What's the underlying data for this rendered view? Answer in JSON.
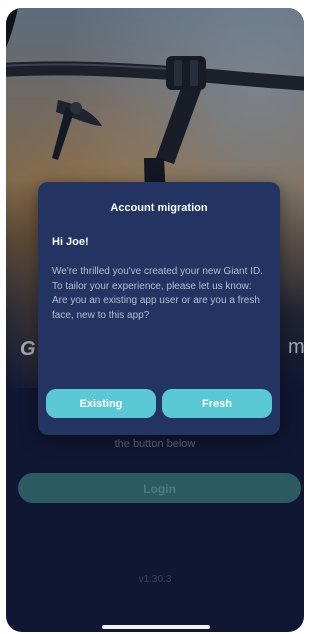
{
  "background": {
    "brand_partial_left": "G",
    "brand_partial_right": "m",
    "hint_text": "the button below",
    "login_label": "Login",
    "version": "v1.30.3"
  },
  "modal": {
    "title": "Account migration",
    "greeting": "Hi Joe!",
    "body_lines": [
      "We're thrilled you've created your new Giant ID. To tailor your experience, please let us know:",
      "Are you an existing app user or are you a fresh face, new to this app?"
    ],
    "existing_label": "Existing",
    "fresh_label": "Fresh"
  },
  "colors": {
    "modal_bg": "#233463",
    "accent_button": "#5bc8d6",
    "screen_bg": "#141d3c",
    "login_button": "#2c5a63"
  }
}
